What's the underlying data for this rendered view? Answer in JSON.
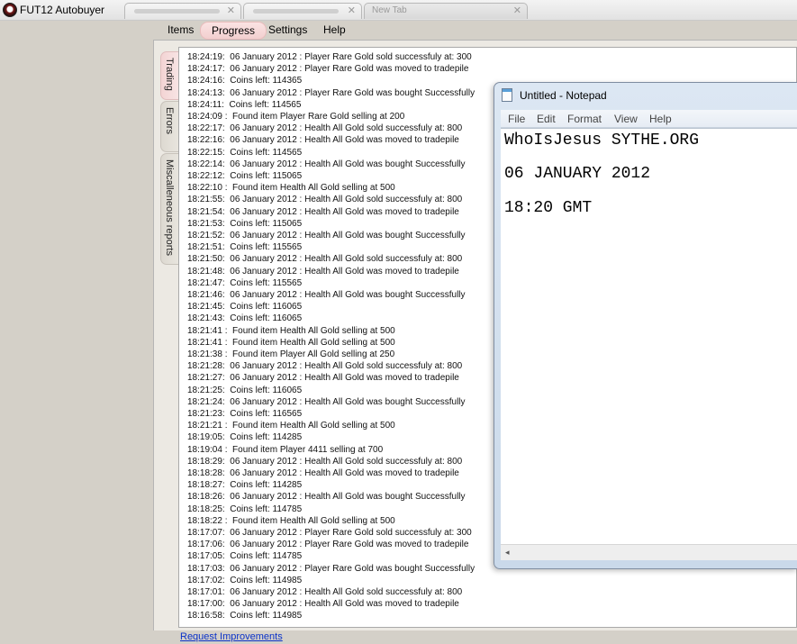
{
  "window": {
    "title": "FUT12 Autobuyer"
  },
  "menu": {
    "items": [
      "Items",
      "Progress",
      "Settings",
      "Help"
    ],
    "active": "Progress"
  },
  "side_tabs": [
    "Trading",
    "Errors",
    "Miscalleneous reports"
  ],
  "log": [
    "18:24:19:  06 January 2012 : Player Rare Gold sold successfuly at: 300",
    "18:24:17:  06 January 2012 : Player Rare Gold was moved to tradepile",
    "18:24:16:  Coins left: 114365",
    "18:24:13:  06 January 2012 : Player Rare Gold was bought Successfully",
    "18:24:11:  Coins left: 114565",
    "18:24:09 :  Found item Player Rare Gold selling at 200",
    "18:22:17:  06 January 2012 : Health All Gold sold successfuly at: 800",
    "18:22:16:  06 January 2012 : Health All Gold was moved to tradepile",
    "18:22:15:  Coins left: 114565",
    "18:22:14:  06 January 2012 : Health All Gold was bought Successfully",
    "18:22:12:  Coins left: 115065",
    "18:22:10 :  Found item Health All Gold selling at 500",
    "18:21:55:  06 January 2012 : Health All Gold sold successfuly at: 800",
    "18:21:54:  06 January 2012 : Health All Gold was moved to tradepile",
    "18:21:53:  Coins left: 115065",
    "18:21:52:  06 January 2012 : Health All Gold was bought Successfully",
    "18:21:51:  Coins left: 115565",
    "18:21:50:  06 January 2012 : Health All Gold sold successfuly at: 800",
    "18:21:48:  06 January 2012 : Health All Gold was moved to tradepile",
    "18:21:47:  Coins left: 115565",
    "18:21:46:  06 January 2012 : Health All Gold was bought Successfully",
    "18:21:45:  Coins left: 116065",
    "18:21:43:  Coins left: 116065",
    "18:21:41 :  Found item Health All Gold selling at 500",
    "18:21:41 :  Found item Health All Gold selling at 500",
    "18:21:38 :  Found item Player All Gold selling at 250",
    "18:21:28:  06 January 2012 : Health All Gold sold successfuly at: 800",
    "18:21:27:  06 January 2012 : Health All Gold was moved to tradepile",
    "18:21:25:  Coins left: 116065",
    "18:21:24:  06 January 2012 : Health All Gold was bought Successfully",
    "18:21:23:  Coins left: 116565",
    "18:21:21 :  Found item Health All Gold selling at 500",
    "18:19:05:  Coins left: 114285",
    "18:19:04 :  Found item Player 4411 selling at 700",
    "18:18:29:  06 January 2012 : Health All Gold sold successfuly at: 800",
    "18:18:28:  06 January 2012 : Health All Gold was moved to tradepile",
    "18:18:27:  Coins left: 114285",
    "18:18:26:  06 January 2012 : Health All Gold was bought Successfully",
    "18:18:25:  Coins left: 114785",
    "18:18:22 :  Found item Health All Gold selling at 500",
    "18:17:07:  06 January 2012 : Player Rare Gold sold successfuly at: 300",
    "18:17:06:  06 January 2012 : Player Rare Gold was moved to tradepile",
    "18:17:05:  Coins left: 114785",
    "18:17:03:  06 January 2012 : Player Rare Gold was bought Successfully",
    "18:17:02:  Coins left: 114985",
    "18:17:01:  06 January 2012 : Health All Gold sold successfuly at: 800",
    "18:17:00:  06 January 2012 : Health All Gold was moved to tradepile",
    "18:16:58:  Coins left: 114985"
  ],
  "footer": {
    "link": "Request Improvements"
  },
  "notepad": {
    "title": "Untitled - Notepad",
    "menu": [
      "File",
      "Edit",
      "Format",
      "View",
      "Help"
    ],
    "lines": [
      "WhoIsJesus SYTHE.ORG",
      "06 JANUARY 2012",
      "18:20 GMT"
    ]
  },
  "browser_tabs": [
    "",
    "",
    "New Tab"
  ],
  "icons": {
    "app": "soccer-ball-icon",
    "notepad": "notepad-icon",
    "close": "close-icon",
    "scroll_left": "arrow-left-icon"
  }
}
